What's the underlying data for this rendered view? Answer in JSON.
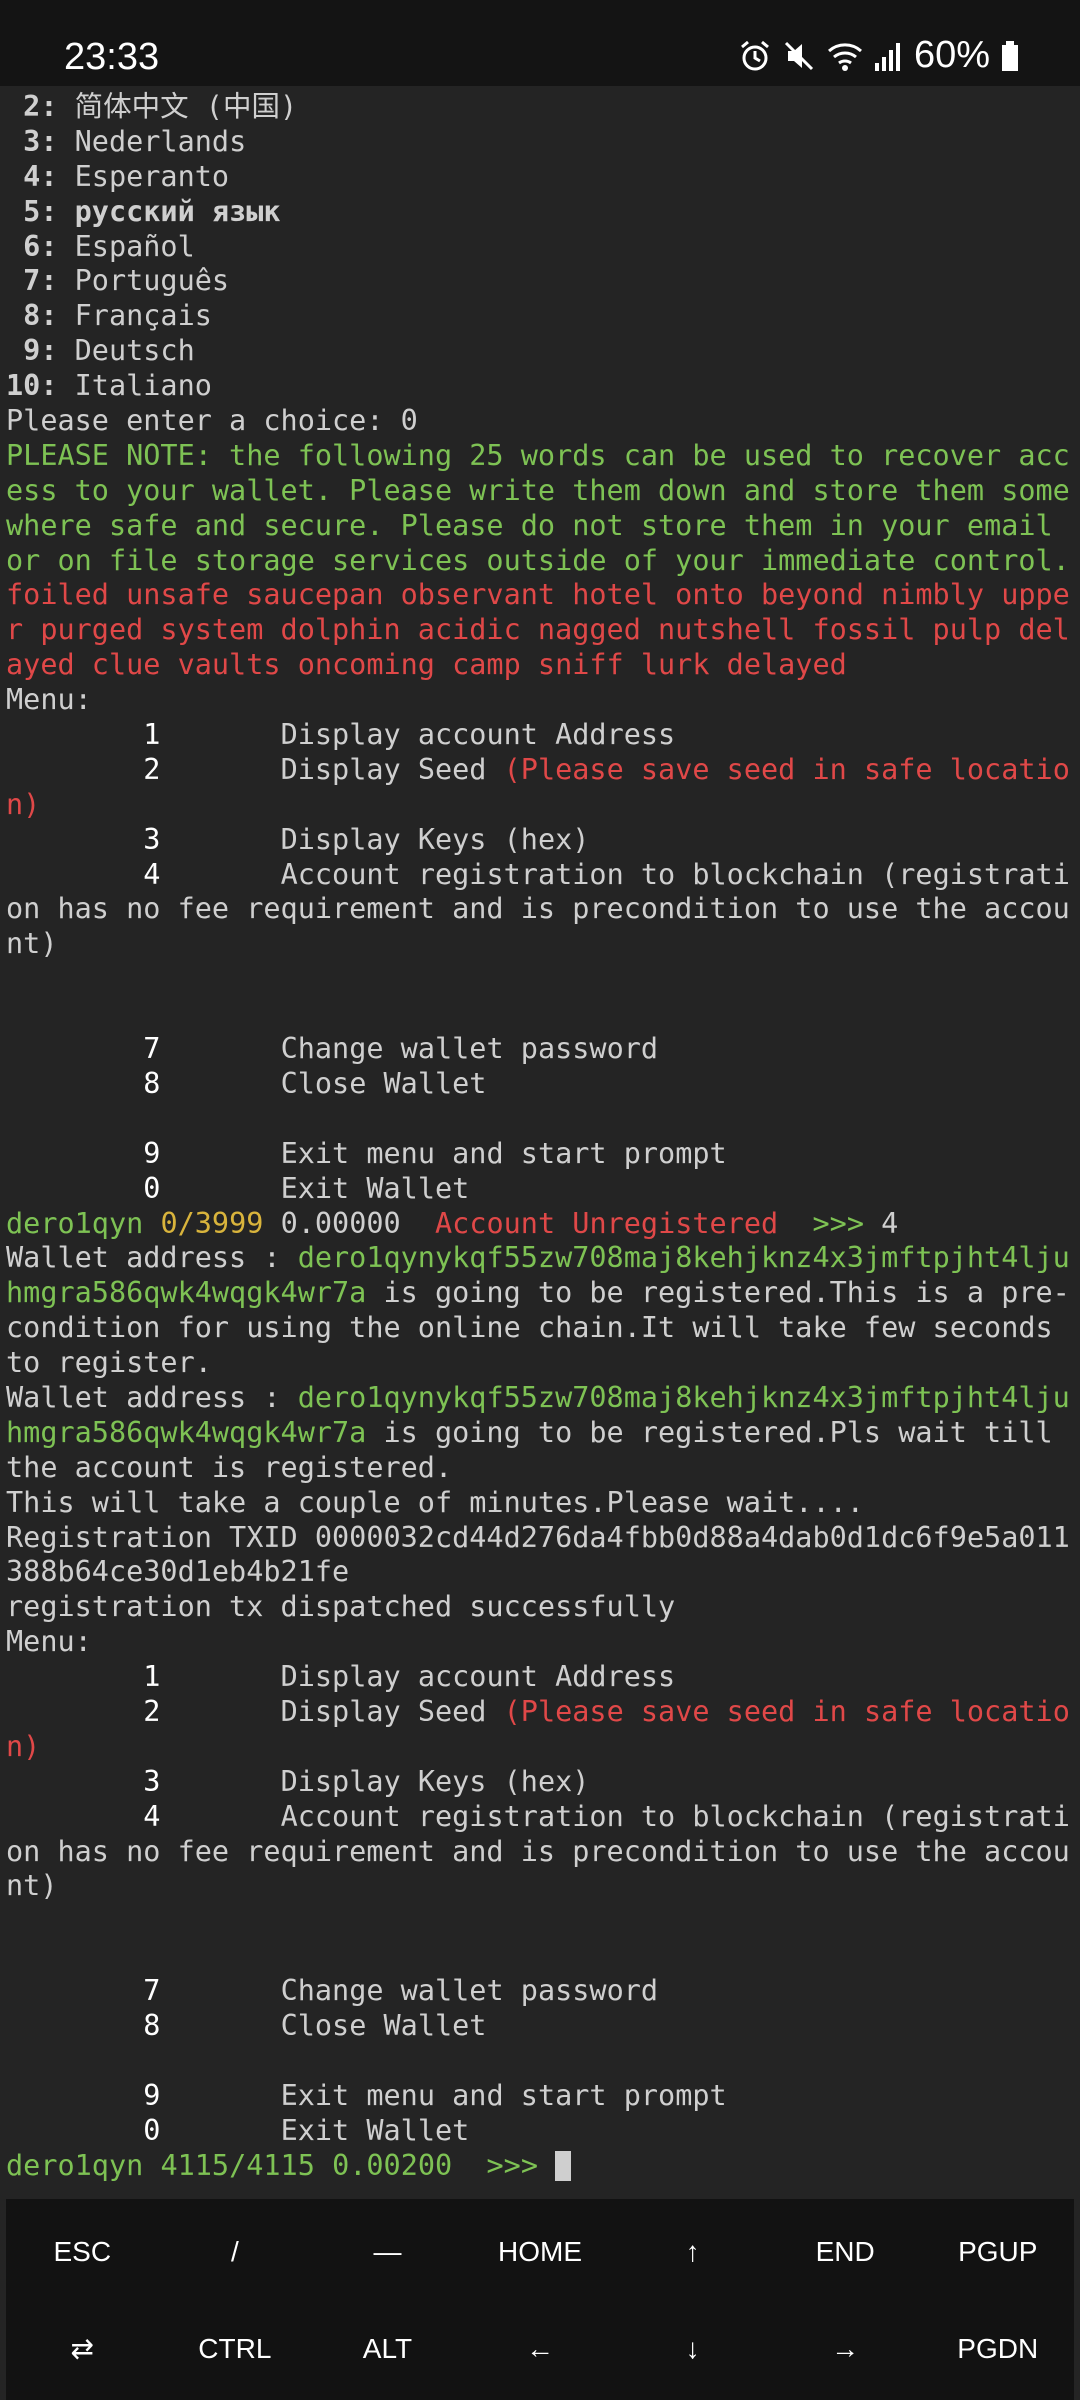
{
  "status_bar": {
    "time": "23:33",
    "battery": "60%"
  },
  "terminal": {
    "languages": [
      {
        "num": " 2:",
        "text": " 简体中文 (中国)"
      },
      {
        "num": " 3:",
        "text": " Nederlands"
      },
      {
        "num": " 4:",
        "text": " Esperanto"
      },
      {
        "num": " 5:",
        "text": " русский язык"
      },
      {
        "num": " 6:",
        "text": " Español"
      },
      {
        "num": " 7:",
        "text": " Português"
      },
      {
        "num": " 8:",
        "text": " Français"
      },
      {
        "num": " 9:",
        "text": " Deutsch"
      },
      {
        "num": "10:",
        "text": " Italiano"
      }
    ],
    "choice_prompt": "Please enter a choice: 0",
    "note_lines": [
      "PLEASE NOTE: the following 25 words can be used to recover acc",
      "ess to your wallet. Please write them down and store them some",
      "where safe and secure. Please do not store them in your email",
      "or on file storage services outside of your immediate control."
    ],
    "seed_lines": [
      "foiled unsafe saucepan observant hotel onto beyond nimbly uppe",
      "r purged system dolphin acidic nagged nutshell fossil pulp del",
      "ayed clue vaults oncoming camp sniff lurk delayed"
    ],
    "menu": {
      "label": "Menu:",
      "item1_num": "1",
      "item1_text": "Display account Address",
      "item2_num": "2",
      "item2_text": "Display Seed ",
      "item2_warning_a": "(Please save seed in safe locatio",
      "item2_warning_b": "n)",
      "item3_num": "3",
      "item3_text": "Display Keys (hex)",
      "item4_num": "4",
      "item4_text": "Account registration to blockchain (registrati",
      "item4_cont_a": "on has no fee requirement and is precondition to use the accou",
      "item4_cont_b": "nt)",
      "item7_num": "7",
      "item7_text": "Change wallet password",
      "item8_num": "8",
      "item8_text": "Close Wallet",
      "item9_num": "9",
      "item9_text": "Exit menu and start prompt",
      "item0_num": "0",
      "item0_text": "Exit Wallet"
    },
    "prompt1": {
      "wallet": "dero1qyn",
      "height": "0/3999",
      "balance": "0.00000",
      "status": "Account Unregistered",
      "arrows": ">>>",
      "input": "4"
    },
    "registration": {
      "wallet_label": "Wallet address : ",
      "addr_a": "dero1qynykqf55zw708maj8kehjknz4x3jmftpjht4lju",
      "addr_b": "hmgra586qwk4wqgk4wr7a",
      "msg1_a": " is going to be registered.This is a pre-",
      "msg1_b": "condition for using the online chain.It will take few seconds",
      "msg1_c": "to register.",
      "msg2_a": " is going to be registered.Pls wait till",
      "msg2_b": "the account is registered.",
      "wait_msg": "This will take a couple of minutes.Please wait....",
      "txid_a": "Registration TXID 0000032cd44d276da4fbb0d88a4dab0d1dc6f9e5a011",
      "txid_b": "388b64ce30d1eb4b21fe",
      "dispatched": "registration tx dispatched successfully"
    },
    "prompt2": {
      "wallet": "dero1qyn",
      "height": "4115/4115",
      "balance": "0.00200",
      "arrows": ">>>"
    }
  },
  "extra_keys": {
    "row1": [
      "ESC",
      "/",
      "—",
      "HOME",
      "↑",
      "END",
      "PGUP"
    ],
    "row2": [
      "⇄",
      "CTRL",
      "ALT",
      "←",
      "↓",
      "→",
      "PGDN"
    ]
  }
}
